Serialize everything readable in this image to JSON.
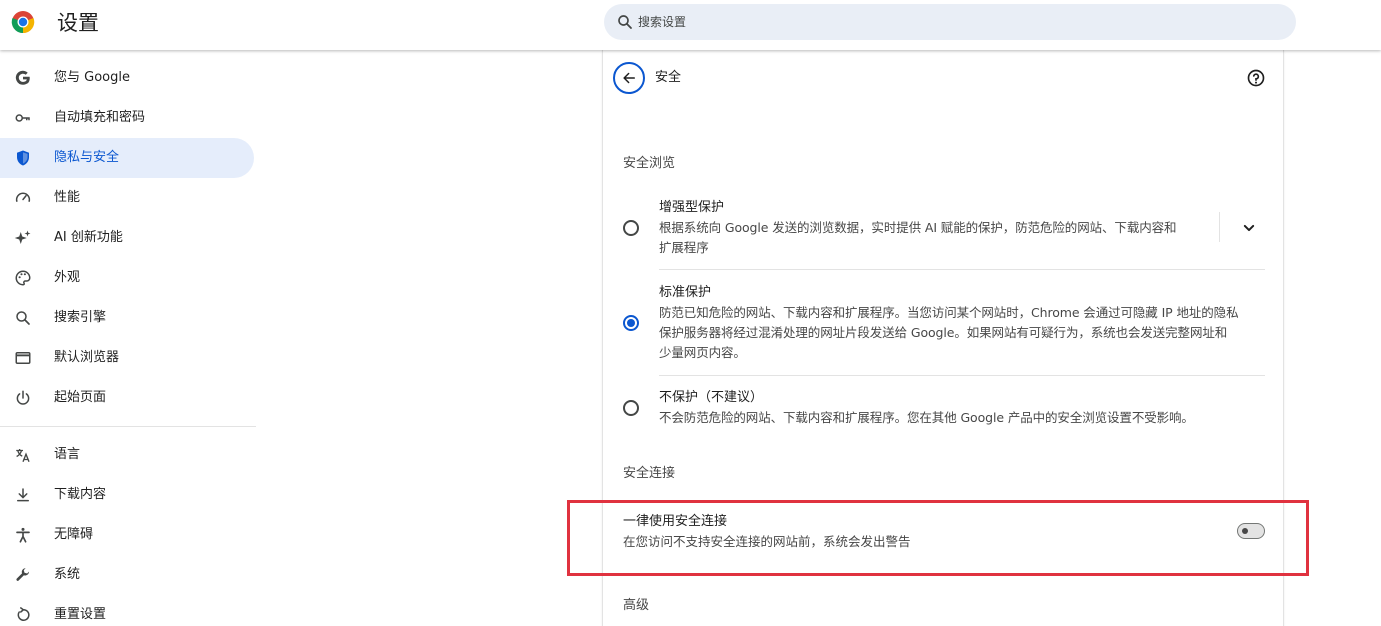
{
  "header": {
    "title": "设置",
    "search_placeholder": "搜索设置"
  },
  "sidebar": {
    "items": [
      {
        "label": "您与 Google",
        "icon": "google-icon"
      },
      {
        "label": "自动填充和密码",
        "icon": "key-icon"
      },
      {
        "label": "隐私与安全",
        "icon": "shield-icon",
        "active": true
      },
      {
        "label": "性能",
        "icon": "speedometer-icon"
      },
      {
        "label": "AI 创新功能",
        "icon": "sparkle-icon"
      },
      {
        "label": "外观",
        "icon": "palette-icon"
      },
      {
        "label": "搜索引擎",
        "icon": "search-icon"
      },
      {
        "label": "默认浏览器",
        "icon": "browser-window-icon"
      },
      {
        "label": "起始页面",
        "icon": "power-icon"
      },
      {
        "label": "语言",
        "icon": "translate-icon"
      },
      {
        "label": "下载内容",
        "icon": "download-icon"
      },
      {
        "label": "无障碍",
        "icon": "accessibility-icon"
      },
      {
        "label": "系统",
        "icon": "wrench-icon"
      },
      {
        "label": "重置设置",
        "icon": "reset-icon"
      }
    ]
  },
  "main": {
    "title": "安全",
    "safe_browsing": {
      "title": "安全浏览",
      "options": [
        {
          "title": "增强型保护",
          "desc_line1": "根据系统向 Google 发送的浏览数据，实时提供 AI 赋能的保护，防范危险的网站、下载内容和",
          "desc_line2": "扩展程序",
          "checked": false
        },
        {
          "title": "标准保护",
          "desc_line1": "防范已知危险的网站、下载内容和扩展程序。当您访问某个网站时，Chrome 会通过可隐藏 IP 地址的隐私",
          "desc_line2": "保护服务器将经过混淆处理的网址片段发送给 Google。如果网站有可疑行为，系统也会发送完整网址和",
          "desc_line3": "少量网页内容。",
          "checked": true
        },
        {
          "title": "不保护（不建议）",
          "desc_line1": "不会防范危险的网站、下载内容和扩展程序。您在其他 Google 产品中的安全浏览设置不受影响。",
          "checked": false
        }
      ]
    },
    "secure_connections": {
      "title": "安全连接",
      "toggle_title": "一律使用安全连接",
      "toggle_desc": "在您访问不支持安全连接的网站前，系统会发出警告",
      "enabled": false
    },
    "advanced_title": "高级"
  },
  "colors": {
    "accent": "#0b57d0",
    "active_bg": "#e5edfb",
    "highlight": "#e0323f"
  }
}
